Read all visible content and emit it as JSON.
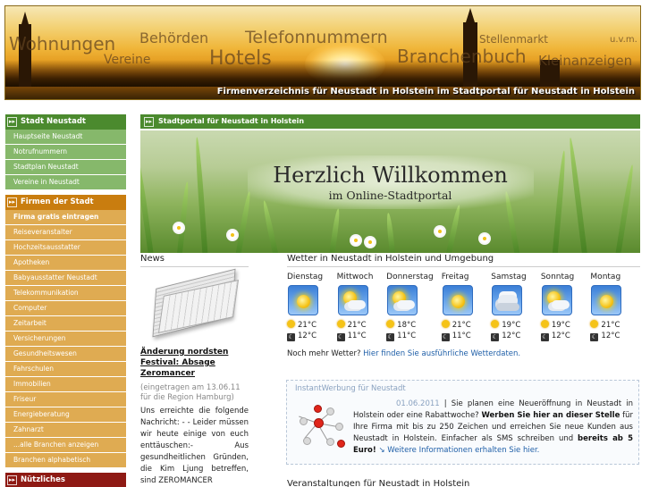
{
  "header": {
    "words": [
      "Wohnungen",
      "Behörden",
      "Telefonnummern",
      "Vereine",
      "Hotels",
      "Branchenbuch",
      "Stellenmarkt",
      "u.v.m.",
      "Kleinanzeigen"
    ],
    "tagline": "Firmenverzeichnis für Neustadt in Holstein im Stadtportal für Neustadt in Holstein"
  },
  "sidebar": {
    "stadt": {
      "heading": "Stadt Neustadt",
      "items": [
        "Hauptseite Neustadt",
        "Notrufnummern",
        "Stadtplan Neustadt",
        "Vereine in Neustadt"
      ]
    },
    "firmen": {
      "heading": "Firmen der Stadt",
      "items": [
        "Firma gratis eintragen",
        "Reiseveranstalter",
        "Hochzeitsausstatter",
        "Apotheken",
        "Babyausstatter Neustadt",
        "Telekommunikation",
        "Computer",
        "Zeitarbeit",
        "Versicherungen",
        "Gesundheitswesen",
        "Fahrschulen",
        "Immobilien",
        "Friseur",
        "Energieberatung",
        "Zahnarzt",
        "...alle Branchen anzeigen",
        "Branchen alphabetisch"
      ]
    },
    "nuetzliches": {
      "heading": "Nützliches"
    }
  },
  "main": {
    "bar_title": "Stadtportal für Neustadt in Holstein",
    "welcome_title": "Herzlich Willkommen",
    "welcome_subtitle": "im Online-Stadtportal"
  },
  "news": {
    "title": "News",
    "headline": "Änderung nordsten Festival: Absage Zeromancer",
    "meta": "(eingetragen am 13.06.11 für die Region Hamburg)",
    "text": "Uns erreichte die folgende Nachricht: - - Leider müssen wir heute einige von euch enttäuschen:- Aus gesundheitlichen Gründen, die Kim Ljung betreffen, sind ZEROMANCER"
  },
  "weather": {
    "title": "Wetter in Neustadt in Holstein und Umgebung",
    "days": [
      {
        "name": "Dienstag",
        "icon": "sun-icon",
        "high": "21°C",
        "low": "12°C"
      },
      {
        "name": "Mittwoch",
        "icon": "sun-cloud-icon",
        "high": "21°C",
        "low": "11°C"
      },
      {
        "name": "Donnerstag",
        "icon": "sun-cloud-icon",
        "high": "18°C",
        "low": "11°C"
      },
      {
        "name": "Freitag",
        "icon": "sun-icon",
        "high": "21°C",
        "low": "11°C"
      },
      {
        "name": "Samstag",
        "icon": "cloud-icon",
        "high": "19°C",
        "low": "12°C"
      },
      {
        "name": "Sonntag",
        "icon": "sun-cloud-icon",
        "high": "19°C",
        "low": "12°C"
      },
      {
        "name": "Montag",
        "icon": "sun-icon",
        "high": "21°C",
        "low": "12°C"
      }
    ],
    "more_prefix": "Noch mehr Wetter?",
    "more_link": "Hier finden Sie ausführliche Wetterdaten."
  },
  "instant": {
    "title": "InstantWerbung für Neustadt",
    "date": "01.06.2011",
    "sep": " | ",
    "t1": "Sie planen eine Neueröffnung in Neustadt in Holstein oder eine Rabattwoche? ",
    "b1": "Werben Sie hier an dieser Stelle",
    "t2": " für Ihre Firma mit bis zu 250 Zeichen und erreichen Sie neue Kunden aus Neustadt in Holstein. Einfacher als SMS schreiben und ",
    "b2": "bereits ab 5 Euro!",
    "link_arrow": " ↘ ",
    "link": "Weitere Informationen erhalten Sie hier."
  },
  "events": {
    "title": "Veranstaltungen für Neustadt in Holstein"
  },
  "colors": {
    "green": "#4b8a2e",
    "orange": "#c97d0f",
    "red": "#8e1a14",
    "link": "#1f5fa8"
  }
}
